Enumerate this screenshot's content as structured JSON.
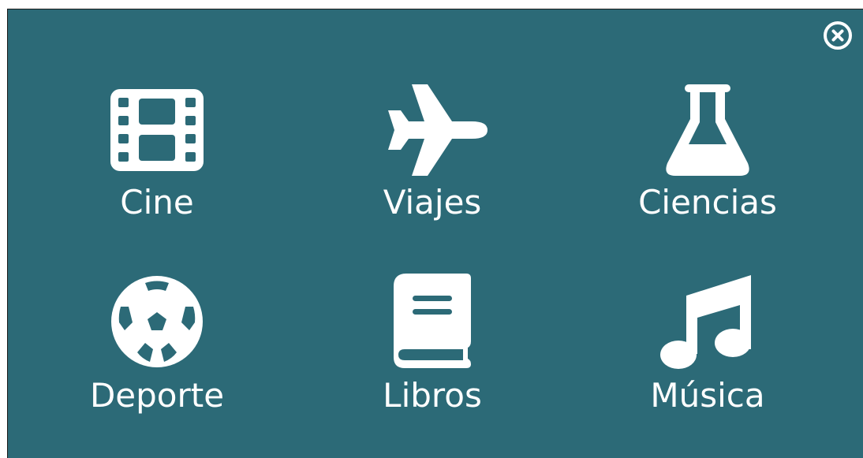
{
  "colors": {
    "panel_background": "#2c6a77",
    "icon_and_text": "#ffffff"
  },
  "close": {
    "icon": "close-circle-icon"
  },
  "menu": {
    "items": [
      {
        "label": "Cine",
        "icon": "film-icon"
      },
      {
        "label": "Viajes",
        "icon": "airplane-icon"
      },
      {
        "label": "Ciencias",
        "icon": "flask-icon"
      },
      {
        "label": "Deporte",
        "icon": "soccer-ball-icon"
      },
      {
        "label": "Libros",
        "icon": "book-icon"
      },
      {
        "label": "Música",
        "icon": "music-note-icon"
      }
    ]
  }
}
